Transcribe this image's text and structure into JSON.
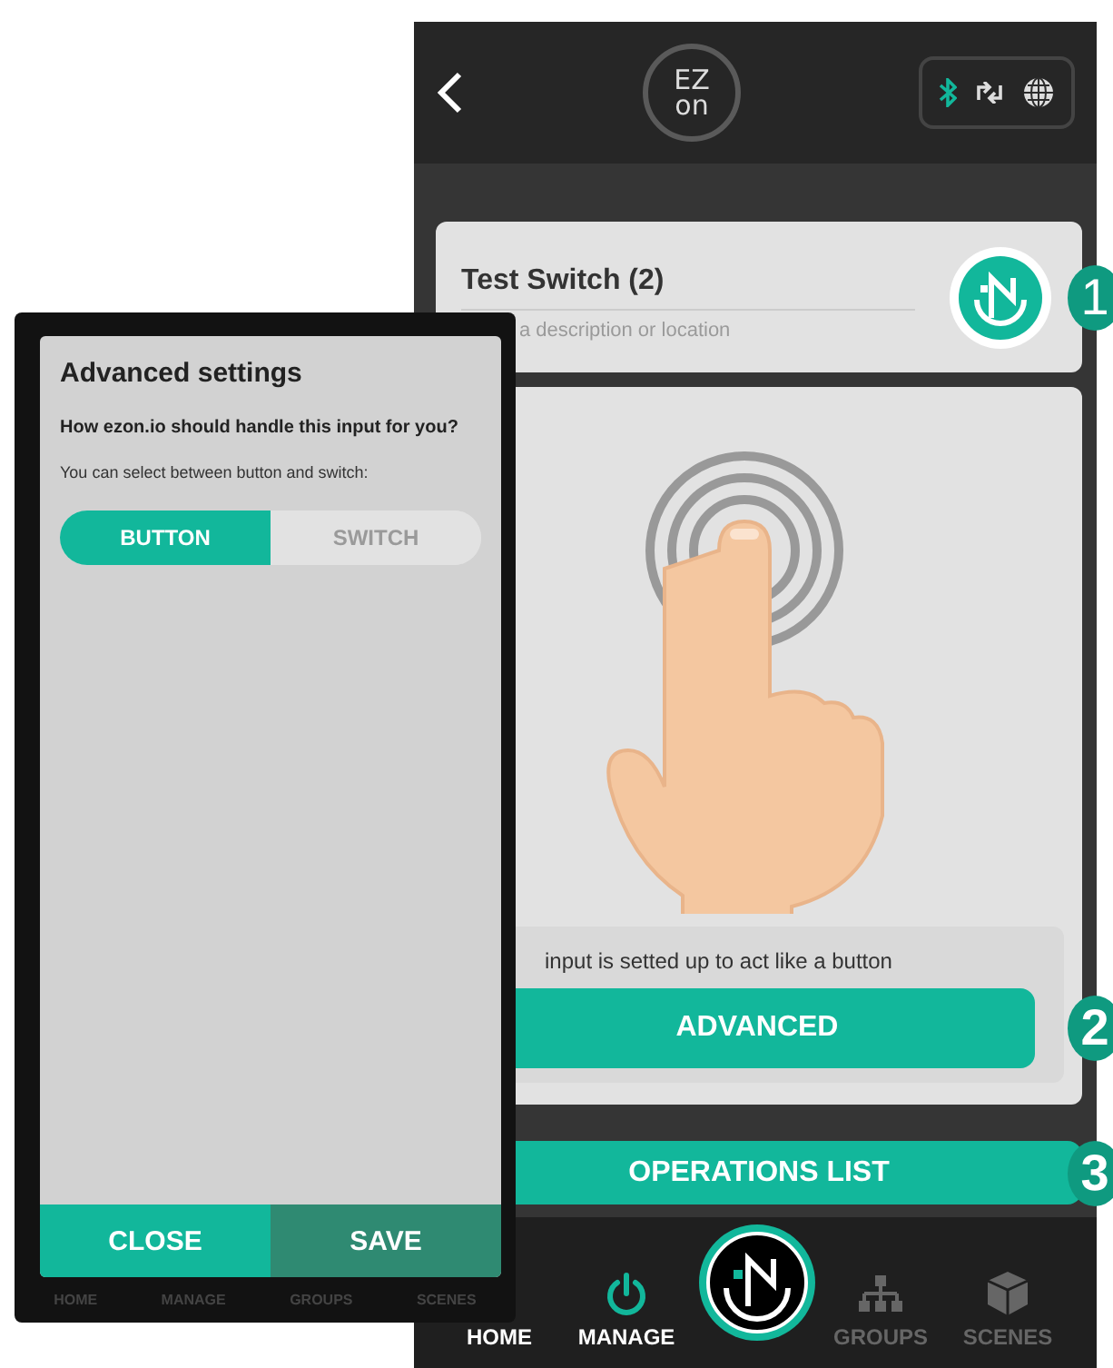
{
  "left_phone": {
    "dialog": {
      "title": "Advanced settings",
      "question": "How ezon.io should handle this input for you?",
      "hint": "You can select between button and switch:",
      "toggle": [
        {
          "label": "BUTTON",
          "selected": true
        },
        {
          "label": "SWITCH",
          "selected": false
        }
      ],
      "buttons": [
        {
          "label": "CLOSE",
          "kind": "secondary"
        },
        {
          "label": "SAVE",
          "kind": "primary"
        }
      ]
    },
    "nav": [
      {
        "label": "HOME"
      },
      {
        "label": "MANAGE"
      },
      {
        "label": "GROUPS"
      },
      {
        "label": "SCENES"
      }
    ]
  },
  "right_phone": {
    "logo": {
      "top": "EZ",
      "bottom": "on"
    },
    "device": {
      "name": "Test Switch (2)",
      "placeholder": "a description or location"
    },
    "mode_text": "input is setted up to act like a button",
    "advanced_button": "ADVANCED",
    "operations_button": "OPERATIONS LIST",
    "nav": [
      {
        "label": "HOME",
        "kind": "home",
        "active": true
      },
      {
        "label": "MANAGE",
        "kind": "manage",
        "active": true
      },
      {
        "label": "GROUPS",
        "kind": "groups",
        "active": false
      },
      {
        "label": "SCENES",
        "kind": "scenes",
        "active": false
      }
    ]
  },
  "callouts": [
    "1",
    "2",
    "3"
  ]
}
